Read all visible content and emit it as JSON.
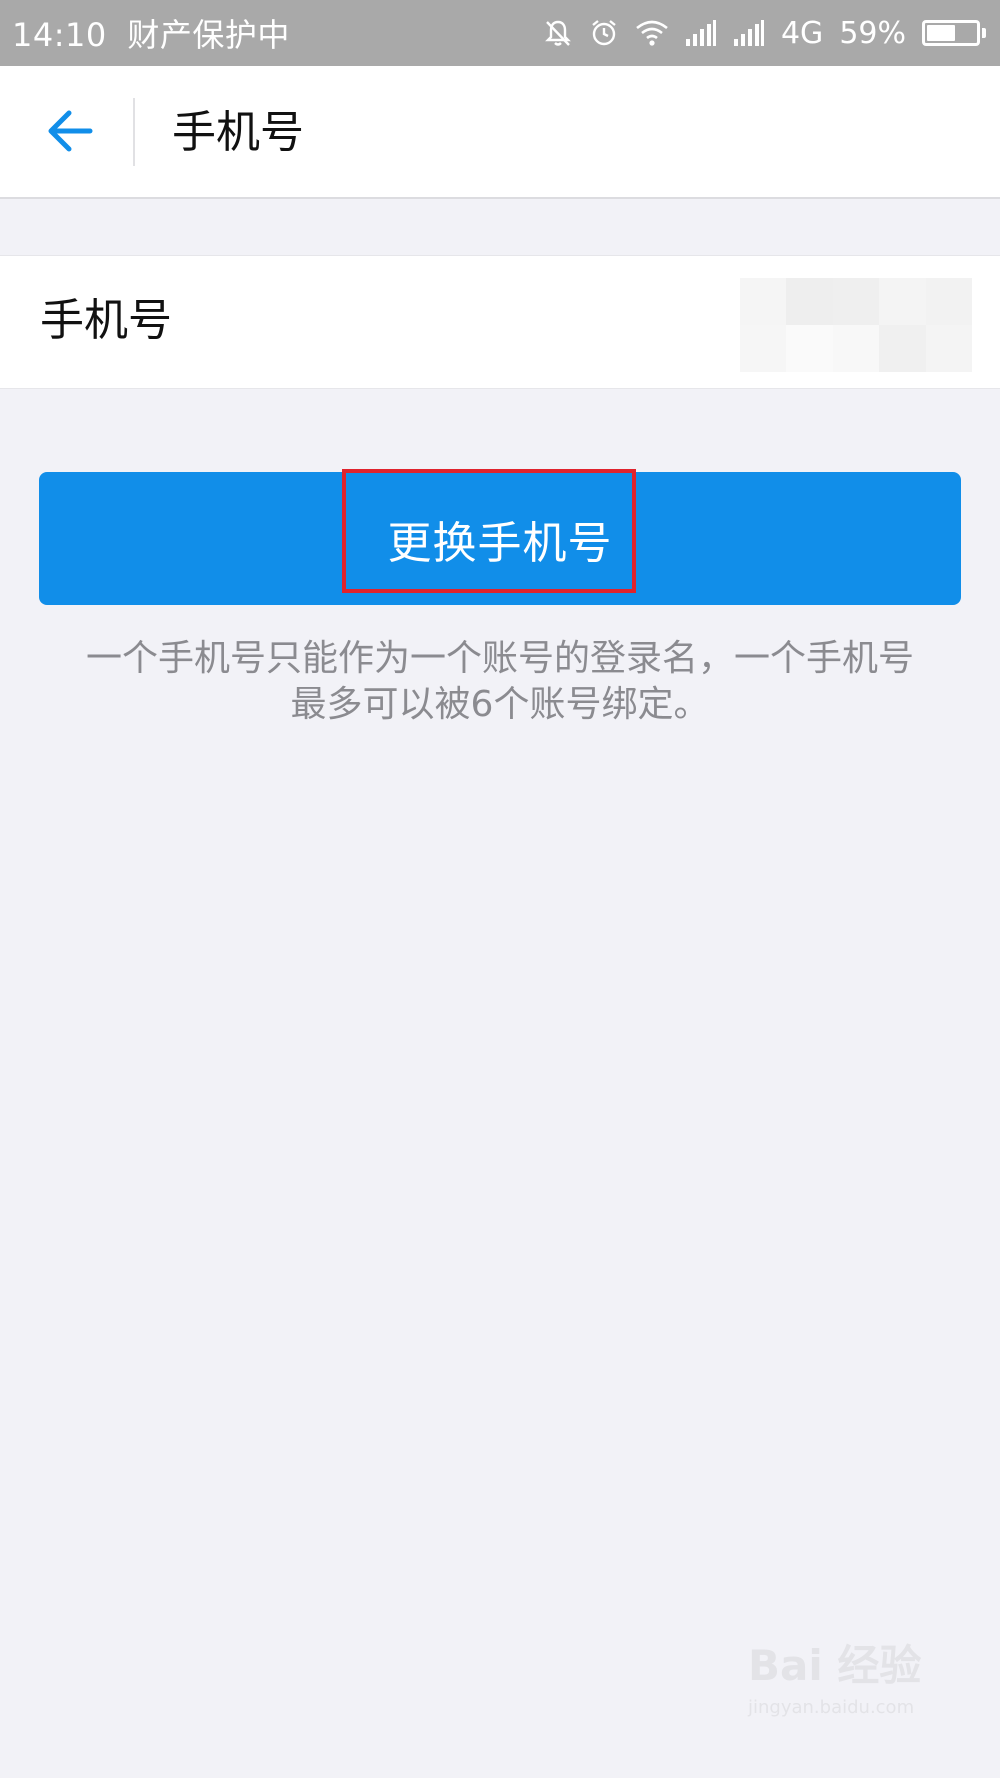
{
  "status_bar": {
    "time": "14:10",
    "mode": "财产保护中",
    "network": "4G",
    "battery": "59%",
    "battery_level": 0.59,
    "icons": [
      "bell-off-icon",
      "alarm-icon",
      "wifi-icon",
      "signal-icon",
      "signal-icon"
    ]
  },
  "header": {
    "back_icon": "arrow-left-icon",
    "title": "手机号"
  },
  "phone_row": {
    "label": "手机号",
    "value": "",
    "value_state": "pixelated"
  },
  "change_button": {
    "label": "更换手机号"
  },
  "note": {
    "line1": "一个手机号只能作为一个账号的登录名，一个手机号",
    "line2": "最多可以被6个账号绑定。"
  },
  "watermark": {
    "logo": "Bai 经验",
    "url": "jingyan.baidu.com"
  },
  "colors": {
    "accent": "#118ee9",
    "highlight": "#e0232d",
    "status_bar": "#a9a9a9",
    "page_bg": "#f2f2f7"
  }
}
